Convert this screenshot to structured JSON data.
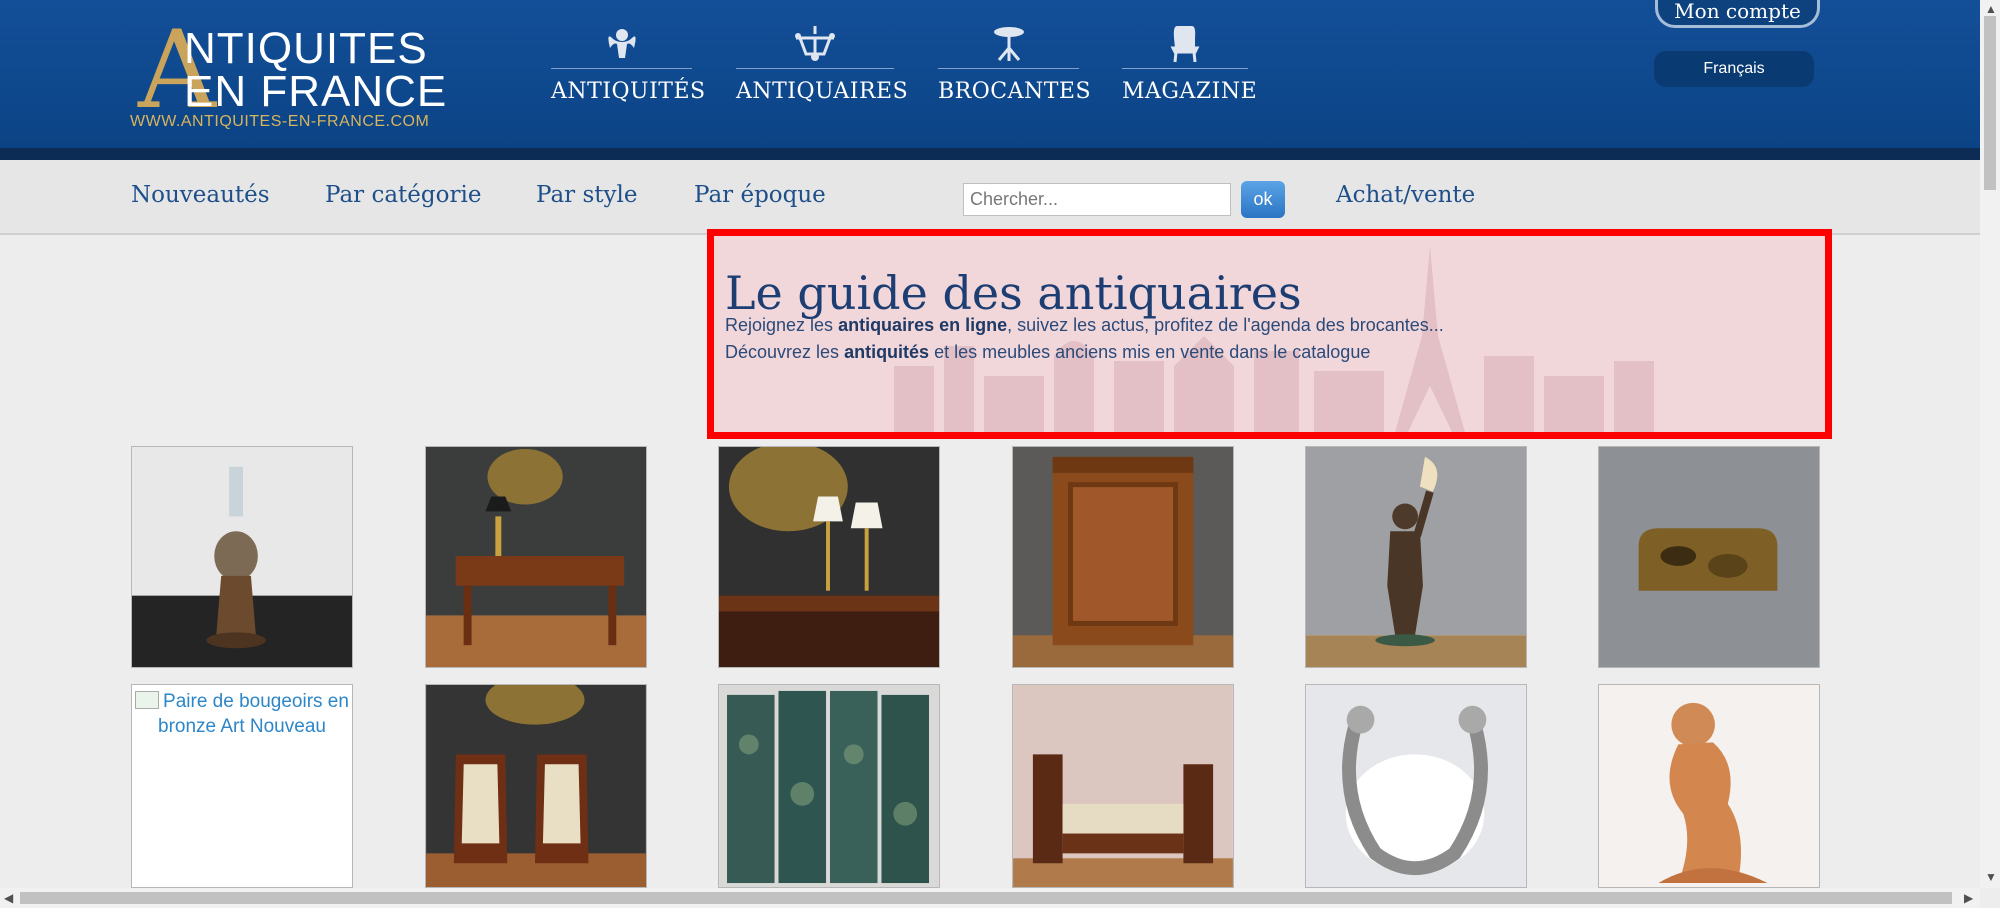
{
  "header": {
    "logo": {
      "line1": "NTIQUITES",
      "line2": "EN FRANCE",
      "big_letter": "A",
      "url": "WWW.ANTIQUITES-EN-FRANCE.COM"
    },
    "nav": [
      {
        "label": "ANTIQUITÉS",
        "icon": "cherub-icon"
      },
      {
        "label": "ANTIQUAIRES",
        "icon": "chandelier-icon"
      },
      {
        "label": "BROCANTES",
        "icon": "table-icon"
      },
      {
        "label": "MAGAZINE",
        "icon": "chair-icon"
      }
    ],
    "account_label": "Mon compte",
    "language": "Français"
  },
  "subnav": {
    "items": [
      "Nouveautés",
      "Par catégorie",
      "Par style",
      "Par époque"
    ],
    "search_placeholder": "Chercher...",
    "search_button": "ok",
    "buy_sell": "Achat/vente"
  },
  "intro": {
    "title": "Le guide des antiquaires",
    "line1": {
      "pre": "Rejoignez les ",
      "bold": "antiquaires en ligne",
      "post": ", suivez les actus, profitez de l'agenda des brocantes..."
    },
    "line2": {
      "pre": "Découvrez les ",
      "bold": "antiquités",
      "post": " et les meubles anciens mis en vente dans le catalogue"
    }
  },
  "products": {
    "row1": [
      "oil-lamp",
      "writing-desk",
      "desk-with-lamps",
      "walnut-cabinet",
      "bronze-statue-lamp",
      "burl-wood-box"
    ],
    "row2_broken_alt": "Paire de bougeoirs en bronze Art Nouveau",
    "row2": [
      "pair-of-armchairs",
      "folding-screen",
      "daybed",
      "silver-bracelet",
      "terracotta-figure"
    ]
  },
  "colors": {
    "header_blue": "#0b4385",
    "accent_red": "#ff0000",
    "gold": "#c9a45a"
  }
}
